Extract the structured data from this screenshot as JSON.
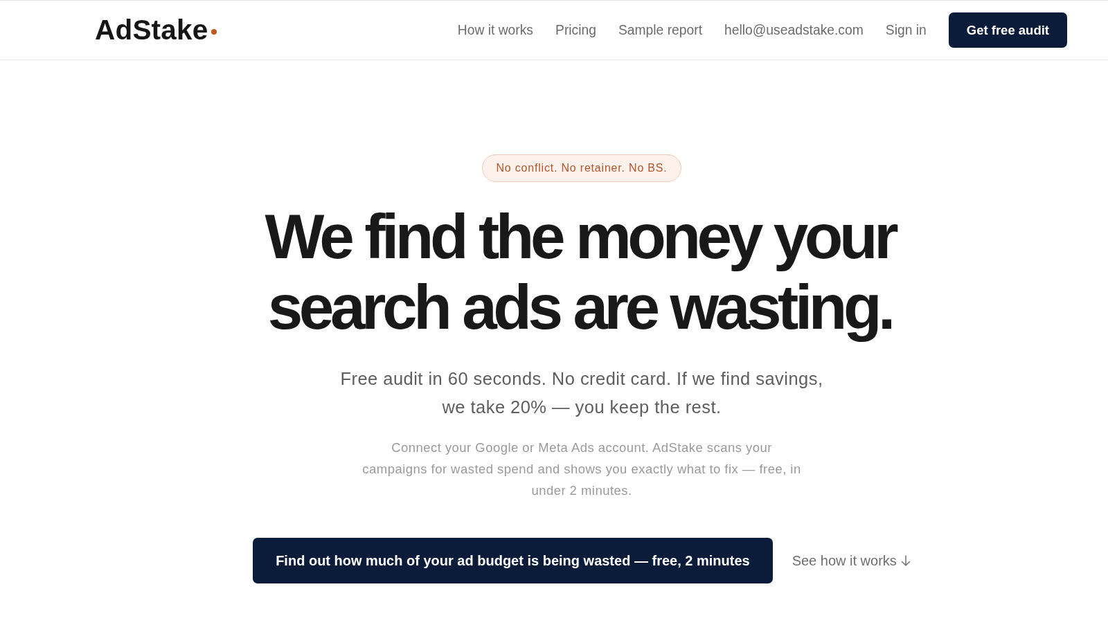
{
  "header": {
    "logo": "AdStake",
    "nav_links": [
      "How it works",
      "Pricing",
      "Sample report",
      "hello@useadstake.com",
      "Sign in"
    ],
    "cta": "Get free audit"
  },
  "hero": {
    "badge": "No conflict. No retainer. No BS.",
    "headline_lines": [
      "We find the money your",
      "search ads are wasting."
    ],
    "subheadline_lines": [
      "Free audit in 60 seconds. No credit card. If we find savings,",
      "we take 20% — you keep the rest."
    ],
    "description_lines": [
      "Connect your Google or Meta Ads account. AdStake scans your",
      "campaigns for wasted spend and shows you exactly what to fix — free, in",
      "under 2 minutes."
    ],
    "primary_cta": "Find out how much of your ad budget is being wasted — free, 2 minutes",
    "secondary_link": "See how it works"
  }
}
